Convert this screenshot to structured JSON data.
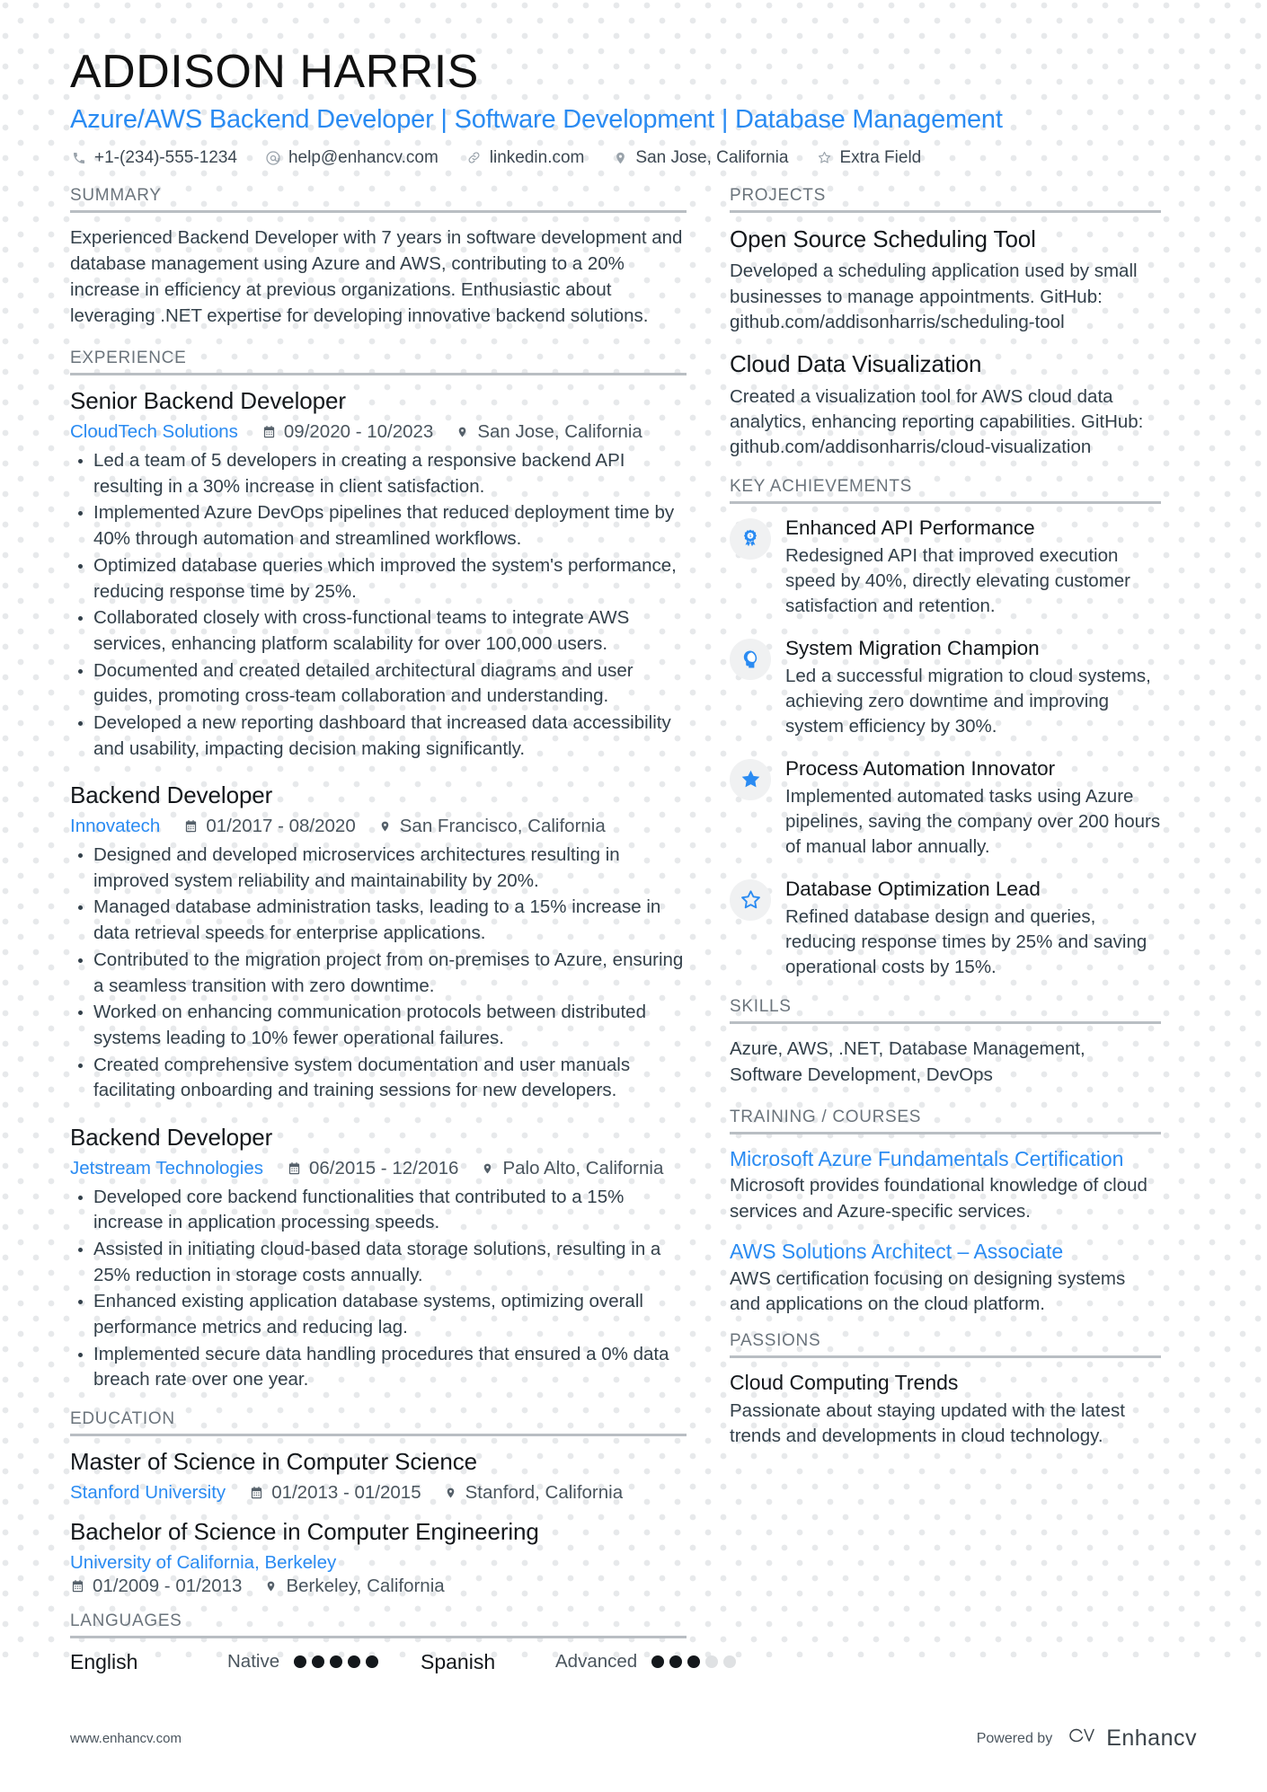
{
  "header": {
    "full_name": "ADDISON HARRIS",
    "job_title": "Azure/AWS Backend Developer | Software Development | Database Management",
    "contacts": [
      {
        "icon": "phone-icon",
        "text": "+1-(234)-555-1234"
      },
      {
        "icon": "email-icon",
        "text": "help@enhancv.com"
      },
      {
        "icon": "link-icon",
        "text": "linkedin.com"
      },
      {
        "icon": "location-icon",
        "text": "San Jose, California"
      },
      {
        "icon": "star-outline-icon",
        "text": "Extra Field"
      }
    ]
  },
  "summary": {
    "heading": "SUMMARY",
    "text": "Experienced Backend Developer with 7 years in software development and database management using Azure and AWS, contributing to a 20% increase in efficiency at previous organizations. Enthusiastic about leveraging .NET expertise for developing innovative backend solutions."
  },
  "experience": {
    "heading": "EXPERIENCE",
    "entries": [
      {
        "title": "Senior Backend Developer",
        "org": "CloudTech Solutions",
        "dates": "09/2020 - 10/2023",
        "location": "San Jose, California",
        "bullets": [
          "Led a team of 5 developers in creating a responsive backend API resulting in a 30% increase in client satisfaction.",
          "Implemented Azure DevOps pipelines that reduced deployment time by 40% through automation and streamlined workflows.",
          "Optimized database queries which improved the system's performance, reducing response time by 25%.",
          "Collaborated closely with cross-functional teams to integrate AWS services, enhancing platform scalability for over 100,000 users.",
          "Documented and created detailed architectural diagrams and user guides, promoting cross-team collaboration and understanding.",
          "Developed a new reporting dashboard that increased data accessibility and usability, impacting decision making significantly."
        ]
      },
      {
        "title": "Backend Developer",
        "org": "Innovatech",
        "dates": "01/2017 - 08/2020",
        "location": "San Francisco, California",
        "bullets": [
          "Designed and developed microservices architectures resulting in improved system reliability and maintainability by 20%.",
          "Managed database administration tasks, leading to a 15% increase in data retrieval speeds for enterprise applications.",
          "Contributed to the migration project from on-premises to Azure, ensuring a seamless transition with zero downtime.",
          "Worked on enhancing communication protocols between distributed systems leading to 10% fewer operational failures.",
          "Created comprehensive system documentation and user manuals facilitating onboarding and training sessions for new developers."
        ]
      },
      {
        "title": "Backend Developer",
        "org": "Jetstream Technologies",
        "dates": "06/2015 - 12/2016",
        "location": "Palo Alto, California",
        "bullets": [
          "Developed core backend functionalities that contributed to a 15% increase in application processing speeds.",
          "Assisted in initiating cloud-based data storage solutions, resulting in a 25% reduction in storage costs annually.",
          "Enhanced existing application database systems, optimizing overall performance metrics and reducing lag.",
          "Implemented secure data handling procedures that ensured a 0% data breach rate over one year."
        ]
      }
    ]
  },
  "education": {
    "heading": "EDUCATION",
    "entries": [
      {
        "title": "Master of Science in Computer Science",
        "org": "Stanford University",
        "dates": "01/2013 - 01/2015",
        "location": "Stanford, California",
        "inline_meta": true
      },
      {
        "title": "Bachelor of Science in Computer Engineering",
        "org": "University of California, Berkeley",
        "dates": "01/2009 - 01/2013",
        "location": "Berkeley, California",
        "inline_meta": false
      }
    ]
  },
  "languages": {
    "heading": "LANGUAGES",
    "items": [
      {
        "name": "English",
        "level": "Native",
        "filled": 5,
        "total": 5
      },
      {
        "name": "Spanish",
        "level": "Advanced",
        "filled": 3,
        "total": 5
      }
    ]
  },
  "projects": {
    "heading": "PROJECTS",
    "items": [
      {
        "title": "Open Source Scheduling Tool",
        "desc": "Developed a scheduling application used by small businesses to manage appointments. GitHub: github.com/addisonharris/scheduling-tool"
      },
      {
        "title": "Cloud Data Visualization",
        "desc": "Created a visualization tool for AWS cloud data analytics, enhancing reporting capabilities. GitHub: github.com/addisonharris/cloud-visualization"
      }
    ]
  },
  "achievements": {
    "heading": "KEY ACHIEVEMENTS",
    "items": [
      {
        "icon": "award-ribbon-icon",
        "title": "Enhanced API Performance",
        "desc": "Redesigned API that improved execution speed by 40%, directly elevating customer satisfaction and retention."
      },
      {
        "icon": "head-profile-icon",
        "title": "System Migration Champion",
        "desc": "Led a successful migration to cloud systems, achieving zero downtime and improving system efficiency by 30%."
      },
      {
        "icon": "star-filled-icon",
        "title": "Process Automation Innovator",
        "desc": "Implemented automated tasks using Azure pipelines, saving the company over 200 hours of manual labor annually."
      },
      {
        "icon": "star-outline-icon",
        "title": "Database Optimization Lead",
        "desc": "Refined database design and queries, reducing response times by 25% and saving operational costs by 15%."
      }
    ]
  },
  "skills": {
    "heading": "SKILLS",
    "text": "Azure, AWS, .NET, Database Management, Software Development, DevOps"
  },
  "training": {
    "heading": "TRAINING / COURSES",
    "items": [
      {
        "title": "Microsoft Azure Fundamentals Certification",
        "desc": "Microsoft provides foundational knowledge of cloud services and Azure-specific services."
      },
      {
        "title": "AWS Solutions Architect – Associate",
        "desc": "AWS certification focusing on designing systems and applications on the cloud platform."
      }
    ]
  },
  "passions": {
    "heading": "PASSIONS",
    "items": [
      {
        "title": "Cloud Computing Trends",
        "desc": "Passionate about staying updated with the latest trends and developments in cloud technology."
      }
    ]
  },
  "footer": {
    "website": "www.enhancv.com",
    "powered_by_label": "Powered by",
    "brand": "Enhancv"
  },
  "colors": {
    "accent": "#2a8bf2",
    "heading_gray": "#6b747c",
    "rule": "#b9bec3",
    "text": "#33404a"
  }
}
